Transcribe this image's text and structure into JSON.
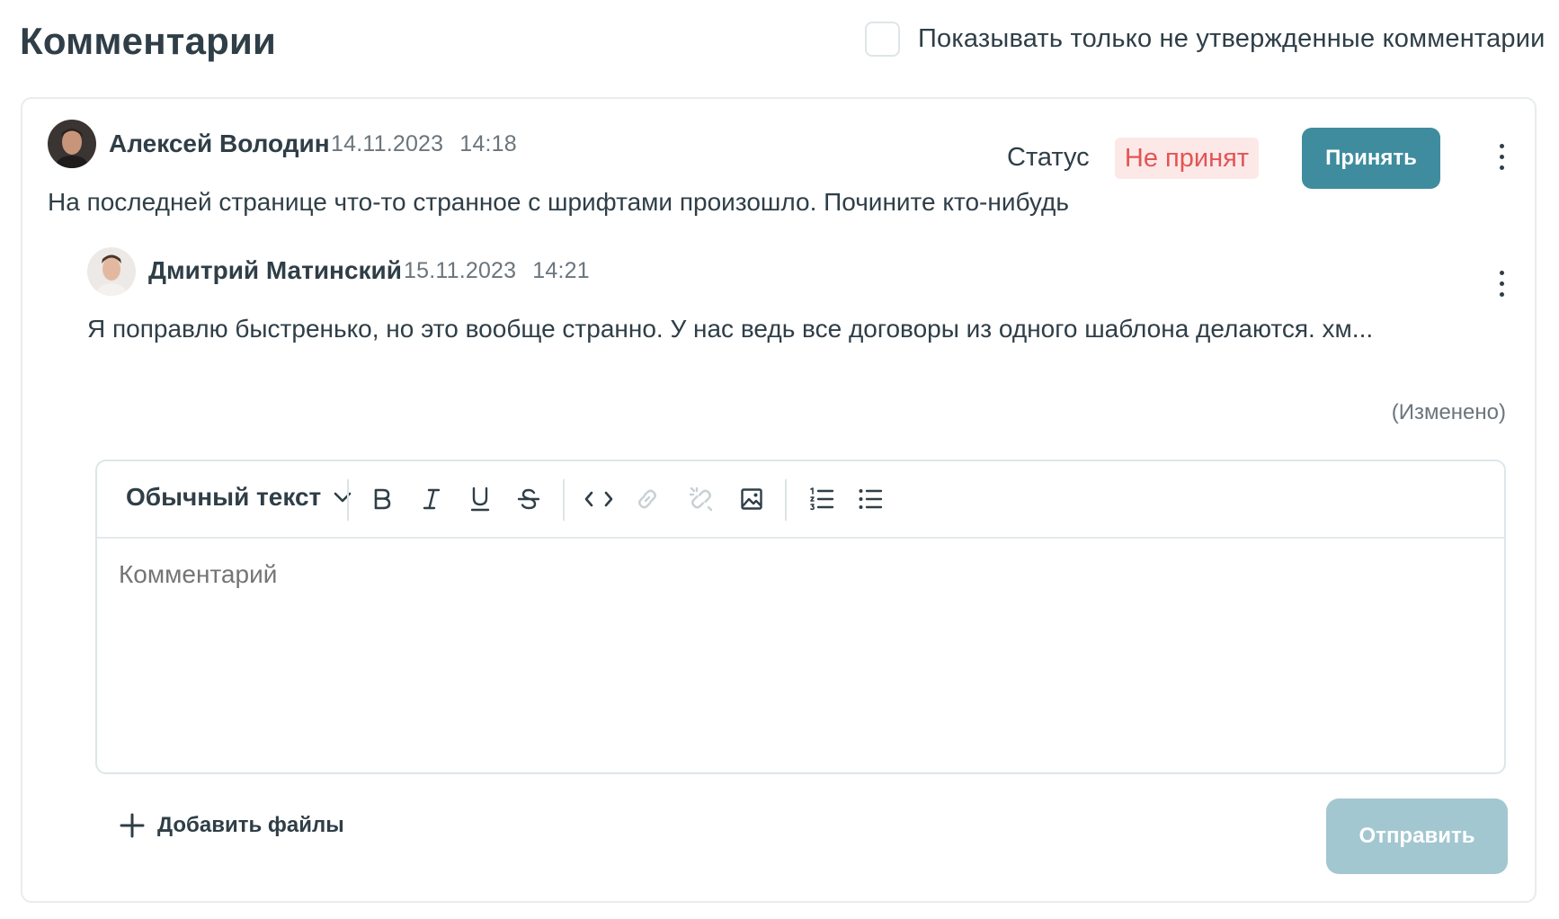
{
  "page": {
    "title": "Комментарии",
    "filter_label": "Показывать только не утвержденные комментарии",
    "filter_checked": false
  },
  "comment": {
    "author": "Алексей Володин",
    "date": "14.11.2023",
    "time": "14:18",
    "status_label": "Статус",
    "status_value": "Не принят",
    "accept_label": "Принять",
    "text": "На последней странице что-то странное с шрифтами произошло. Почините кто-нибудь",
    "reply": {
      "author": "Дмитрий Матинский",
      "date": "15.11.2023",
      "time": "14:21",
      "text": "Я поправлю быстренько, но это вообще странно. У нас ведь все договоры из одного шаблона делаются. хм...",
      "edited_label": "(Изменено)"
    }
  },
  "editor": {
    "style_select": "Обычный текст",
    "placeholder": "Комментарий",
    "toolbar_icons": [
      "bold-icon",
      "italic-icon",
      "underline-icon",
      "strikethrough-icon",
      "code-icon",
      "link-icon",
      "unlink-icon",
      "image-icon",
      "ordered-list-icon",
      "bullet-list-icon"
    ]
  },
  "actions": {
    "add_files_label": "Добавить файлы",
    "send_label": "Отправить"
  },
  "colors": {
    "accent": "#3f8c9e",
    "accent_disabled": "#a2c7d0",
    "status_text": "#e35454",
    "status_bg": "#fde8e8"
  }
}
